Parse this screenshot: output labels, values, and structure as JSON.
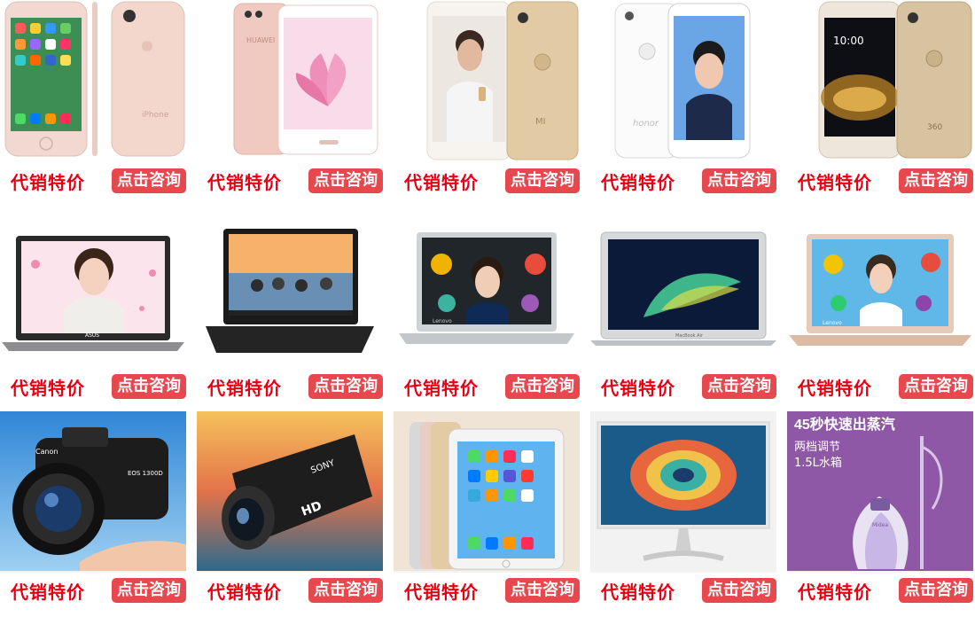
{
  "labels": {
    "price": "代销特价",
    "consult": "点击咨询"
  },
  "products": [
    {
      "name": "iphone-rose-gold",
      "kind": "phone",
      "icon": "smartphone-icon"
    },
    {
      "name": "huawei-pink",
      "kind": "phone",
      "icon": "smartphone-icon"
    },
    {
      "name": "xiaomi-gold",
      "kind": "phone",
      "icon": "smartphone-icon"
    },
    {
      "name": "honor-white",
      "kind": "phone",
      "icon": "smartphone-icon"
    },
    {
      "name": "phone-gold-360",
      "kind": "phone",
      "icon": "smartphone-icon"
    },
    {
      "name": "asus-laptop",
      "kind": "laptop",
      "icon": "laptop-icon"
    },
    {
      "name": "lenovo-black-laptop",
      "kind": "laptop",
      "icon": "laptop-icon"
    },
    {
      "name": "lenovo-silver-laptop",
      "kind": "laptop",
      "icon": "laptop-icon"
    },
    {
      "name": "macbook-air",
      "kind": "laptop",
      "icon": "laptop-icon"
    },
    {
      "name": "lenovo-gold-laptop",
      "kind": "laptop",
      "icon": "laptop-icon"
    },
    {
      "name": "canon-dslr",
      "kind": "camera",
      "icon": "camera-icon"
    },
    {
      "name": "sony-camcorder",
      "kind": "camcorder",
      "icon": "camcorder-icon"
    },
    {
      "name": "ipad",
      "kind": "tablet",
      "icon": "tablet-icon"
    },
    {
      "name": "monitor",
      "kind": "monitor",
      "icon": "monitor-icon"
    },
    {
      "name": "garment-steamer",
      "kind": "steamer",
      "icon": "steamer-icon"
    }
  ],
  "printed_text": {
    "phone_0_brand": "iPhone",
    "phone_2_brand": "MI",
    "phone_3_brand": "honor",
    "phone_4_brand": "360",
    "phone_4_time": "10:00",
    "laptop_0_brand": "ASUS",
    "laptop_2_brand": "Lenovo",
    "laptop_3_brand": "MacBook Air",
    "laptop_4_brand": "Lenovo",
    "camera_brand": "Canon",
    "camera_model": "EOS 1300D",
    "camcorder_brand": "SONY",
    "camcorder_hd": "HD",
    "steamer_headline": "45秒快速出蒸汽",
    "steamer_line1": "两档调节",
    "steamer_line2": "1.5L水箱",
    "steamer_brand": "Midea"
  },
  "colors": {
    "price_red": "#e60012",
    "button_red": "#e8474d",
    "button_text": "#ffffff"
  }
}
